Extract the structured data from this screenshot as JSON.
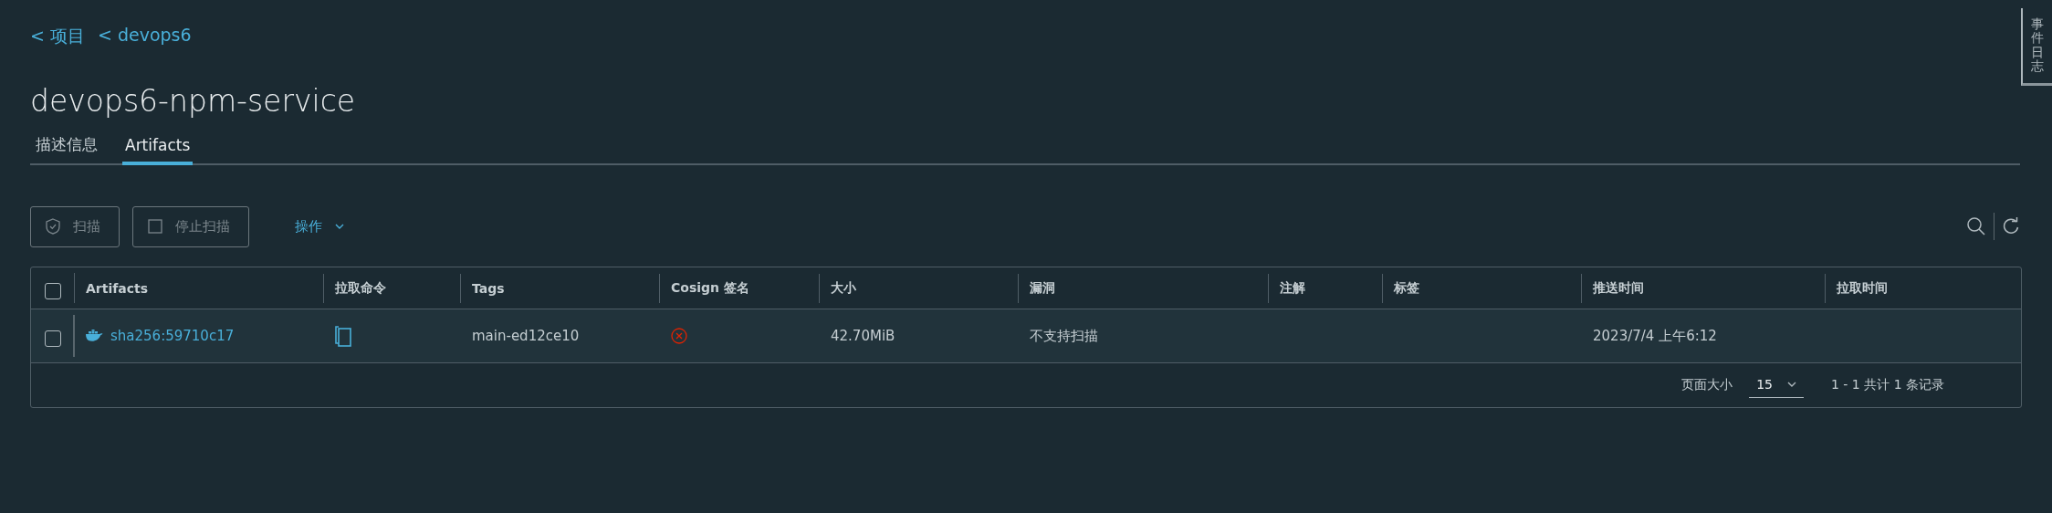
{
  "breadcrumbs": [
    "< 项目",
    "< devops6"
  ],
  "title": "devops6-npm-service",
  "tabs": [
    {
      "label": "描述信息",
      "selected": false
    },
    {
      "label": "Artifacts",
      "selected": true
    }
  ],
  "toolbar": {
    "buttons": [
      {
        "label": "扫描",
        "kind": "scan"
      },
      {
        "label": "停止扫描",
        "kind": "stop"
      }
    ],
    "actions": "操作"
  },
  "table": {
    "all_checked": false,
    "columns": [
      "Artifacts",
      "拉取命令",
      "Tags",
      "Cosign 签名",
      "大小",
      "漏洞",
      "注解",
      "标签",
      "推送时间",
      "拉取时间"
    ],
    "rows": [
      {
        "checked": false,
        "artifact": "sha256:59710c17",
        "tags": "main-ed12ce10",
        "signed": false,
        "size": "42.70MiB",
        "vulnerabilities": "不支持扫描",
        "push_time": "2023/7/4 上午6:12"
      }
    ]
  },
  "pagination": {
    "page_size_label": "页面大小",
    "page_size": "15",
    "summary": "1 - 1 共计 1 条记录"
  },
  "side_tab": "事件日志"
}
